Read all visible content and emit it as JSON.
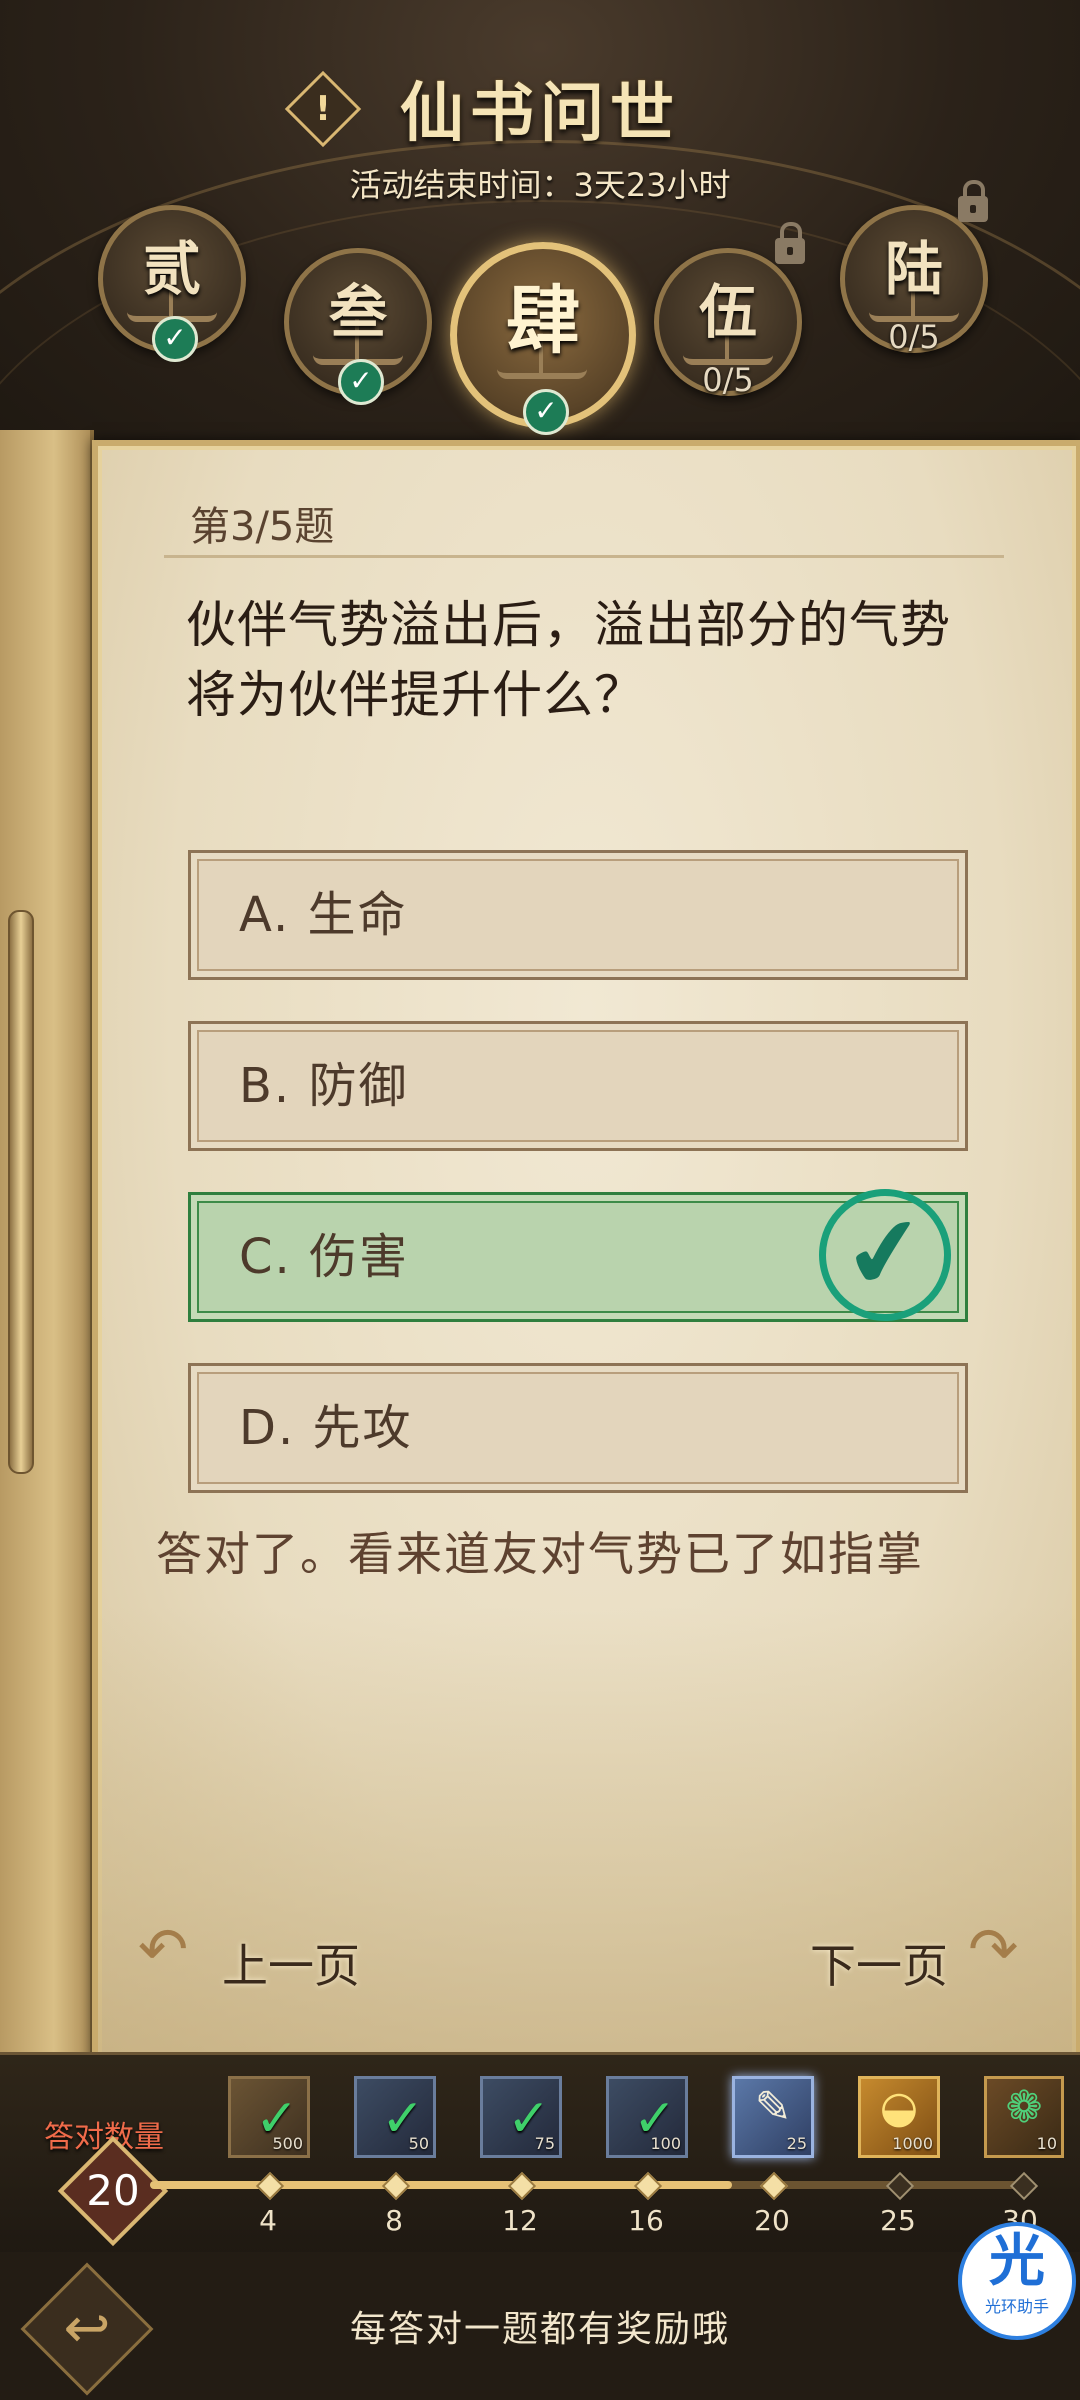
{
  "header": {
    "title": "仙书问世",
    "info_icon": "!",
    "end_time": "活动结束时间：3天23小时",
    "chapters": [
      {
        "char": "贰",
        "progress": "",
        "completed": true,
        "locked": false
      },
      {
        "char": "叁",
        "progress": "",
        "completed": true,
        "locked": false
      },
      {
        "char": "肆",
        "progress": "",
        "completed": true,
        "locked": false,
        "active": true
      },
      {
        "char": "伍",
        "progress": "0/5",
        "completed": false,
        "locked": true
      },
      {
        "char": "陆",
        "progress": "0/5",
        "completed": false,
        "locked": true
      }
    ]
  },
  "quiz": {
    "number": "第3/5题",
    "question": "伙伴气势溢出后，溢出部分的气势将为伙伴提升什么？",
    "options": [
      {
        "label": "A. 生命",
        "correct": false
      },
      {
        "label": "B. 防御",
        "correct": false
      },
      {
        "label": "C. 伤害",
        "correct": true
      },
      {
        "label": "D. 先攻",
        "correct": false
      }
    ],
    "feedback": "答对了。看来道友对气势已了如指掌",
    "prev_label": "上一页",
    "next_label": "下一页"
  },
  "rewards": {
    "count_label": "答对数量",
    "count_value": "20",
    "progress_fraction": 0.667,
    "milestones": [
      "4",
      "8",
      "12",
      "16",
      "20",
      "25",
      "30"
    ],
    "items": [
      {
        "qty": "500",
        "icon": "dumbbell-icon",
        "claimed": true
      },
      {
        "qty": "50",
        "icon": "book-icon",
        "claimed": true
      },
      {
        "qty": "75",
        "icon": "book-icon",
        "claimed": true
      },
      {
        "qty": "100",
        "icon": "book-icon",
        "claimed": true
      },
      {
        "qty": "25",
        "icon": "scroll-icon",
        "claimed": false
      },
      {
        "qty": "1000",
        "icon": "gold-ingot-icon",
        "claimed": false
      },
      {
        "qty": "10",
        "icon": "jade-icon",
        "claimed": false
      }
    ]
  },
  "footer": {
    "tip": "每答对一题都有奖励哦",
    "assistant_glyph": "光",
    "assistant_name": "光环助手"
  },
  "colors": {
    "correct_green": "#1aa07a",
    "gold": "#e3c27a",
    "paper": "#e8dcc0"
  }
}
